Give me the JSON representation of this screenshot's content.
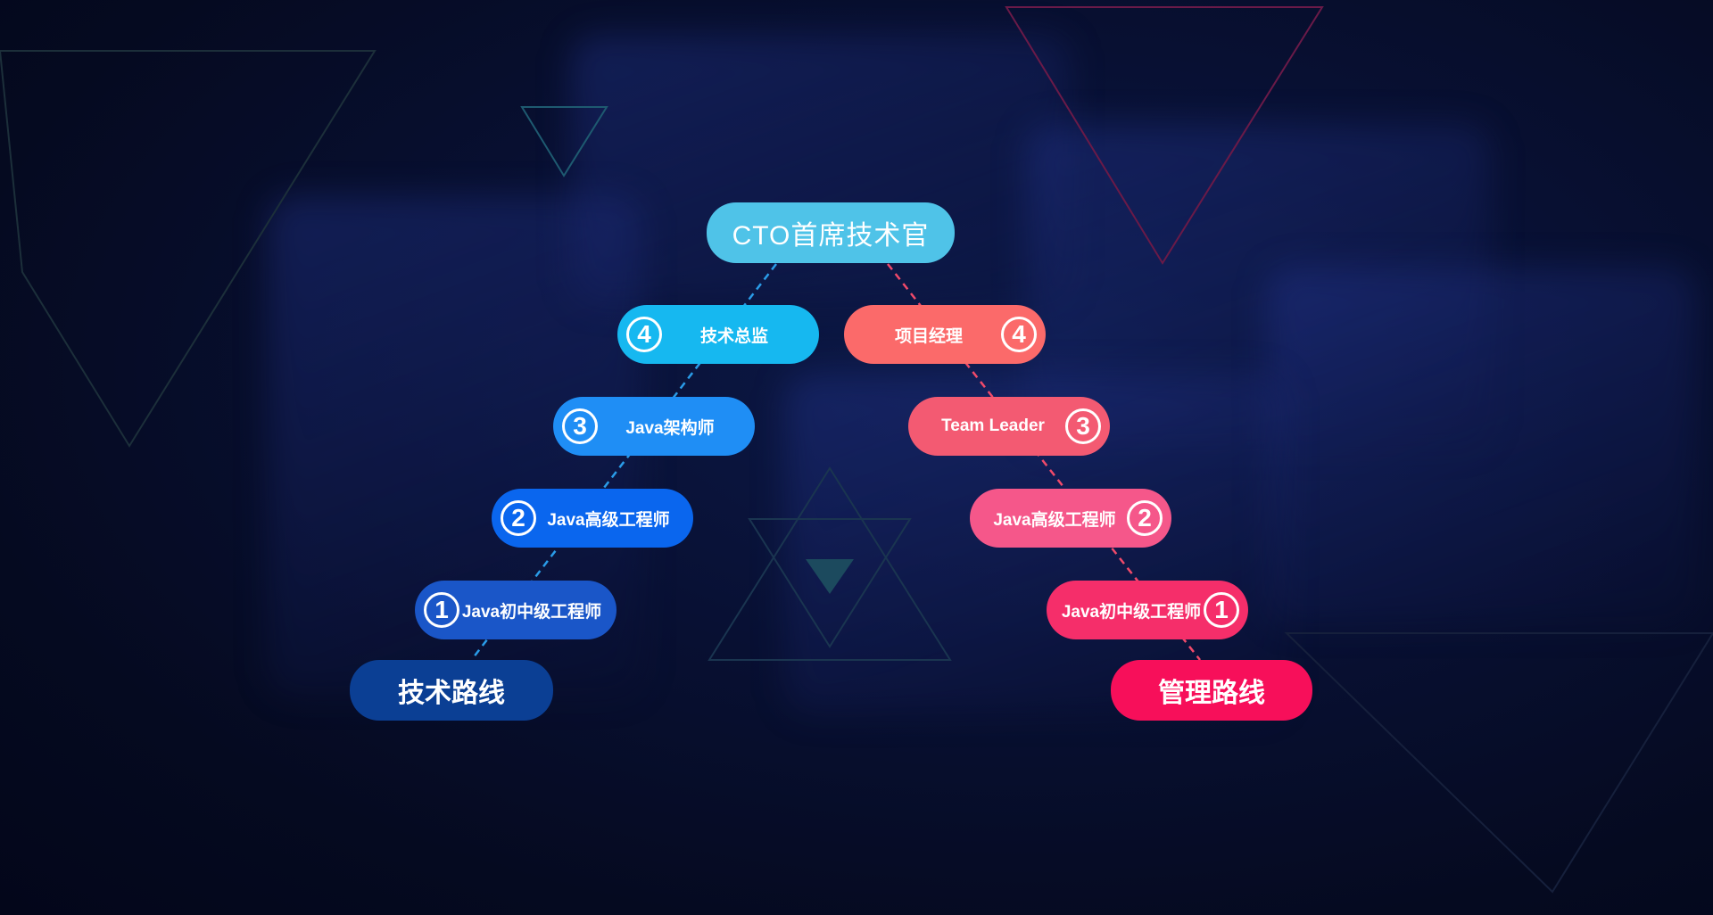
{
  "top_role": "CTO首席技术官",
  "tech_route": {
    "title": "技术路线",
    "levels": [
      {
        "num": "4",
        "label": "技术总监"
      },
      {
        "num": "3",
        "label": "Java架构师"
      },
      {
        "num": "2",
        "label": "Java高级工程师"
      },
      {
        "num": "1",
        "label": "Java初中级工程师"
      }
    ]
  },
  "mgmt_route": {
    "title": "管理路线",
    "levels": [
      {
        "num": "4",
        "label": "项目经理"
      },
      {
        "num": "3",
        "label": "Team Leader"
      },
      {
        "num": "2",
        "label": "Java高级工程师"
      },
      {
        "num": "1",
        "label": "Java初中级工程师"
      }
    ]
  },
  "colors": {
    "top": "#4fc3e8",
    "tech": [
      "#16b8f0",
      "#1f8ef5",
      "#0a66ee",
      "#1a56c8",
      "#0b3f94"
    ],
    "mgmt": [
      "#fb6a6a",
      "#f35a72",
      "#f5578a",
      "#f52e6a",
      "#f70f5a"
    ]
  }
}
